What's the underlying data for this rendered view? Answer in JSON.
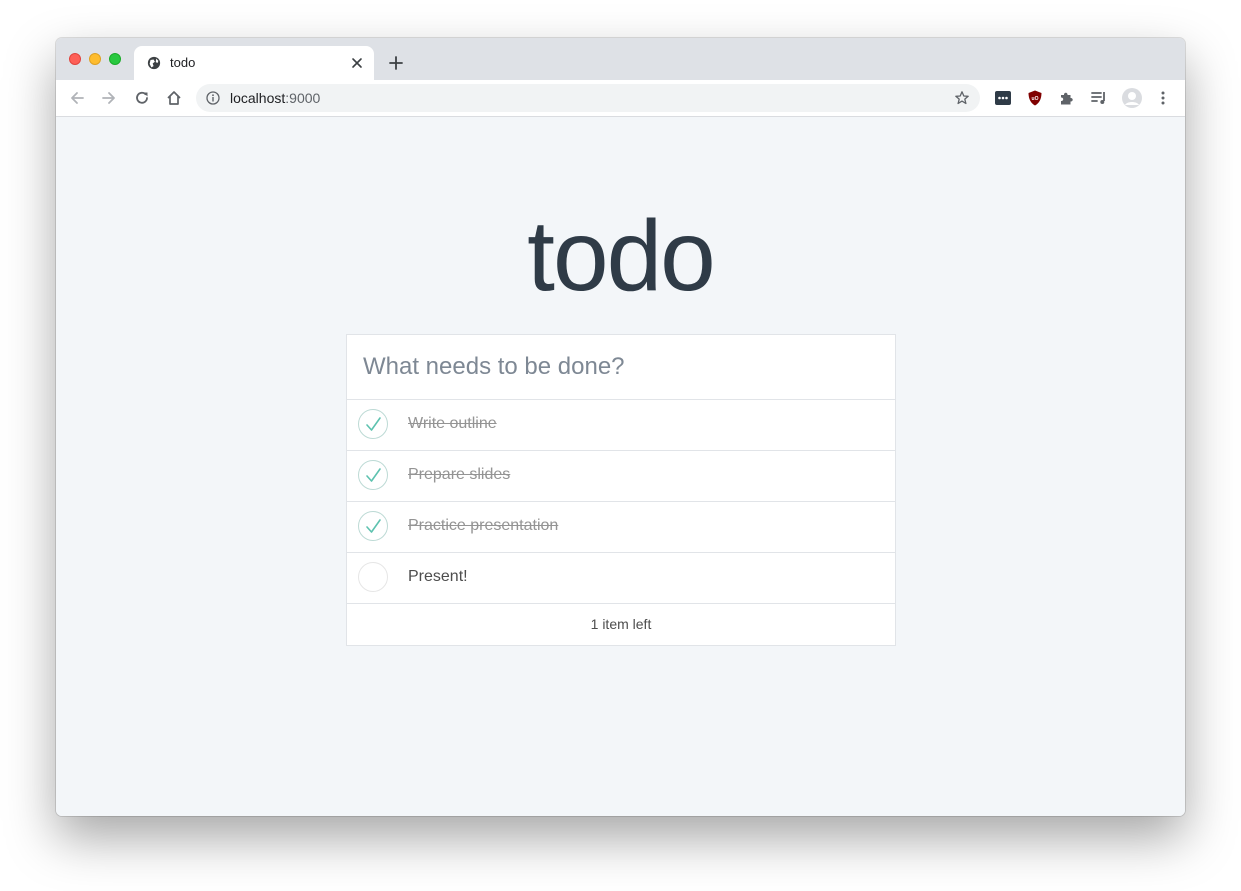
{
  "browser": {
    "tab_title": "todo",
    "url_host": "localhost",
    "url_port": ":9000"
  },
  "app": {
    "title": "todo",
    "new_todo_placeholder": "What needs to be done?",
    "todos": [
      {
        "label": "Write outline",
        "completed": true
      },
      {
        "label": "Prepare slides",
        "completed": true
      },
      {
        "label": "Practice presentation",
        "completed": true
      },
      {
        "label": "Present!",
        "completed": false
      }
    ],
    "footer_text": "1 item left"
  },
  "colors": {
    "accent_check": "#5dc2af",
    "title": "#2f3b47",
    "background": "#f3f6f9"
  }
}
